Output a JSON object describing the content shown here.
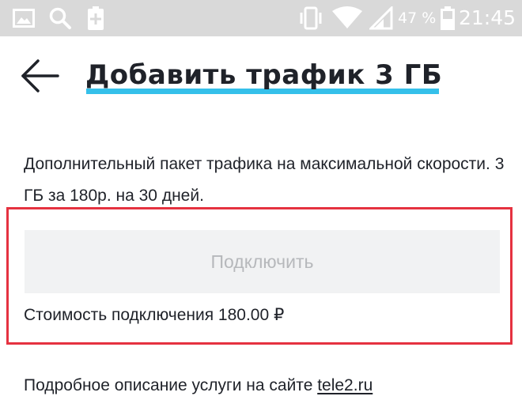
{
  "status_bar": {
    "battery_percent": "47 %",
    "time": "21:45",
    "icons": [
      "gallery-icon",
      "search-icon",
      "battery-saver-icon",
      "vibrate-icon",
      "wifi-icon",
      "signal-icon",
      "battery-icon"
    ]
  },
  "header": {
    "title": "Добавить трафик 3 ГБ",
    "back_icon": "arrow-left-icon",
    "underline_color": "#35c0ea"
  },
  "description": "Дополнительный пакет трафика на максимальной скорости. 3 ГБ за 180р. на 30 дней.",
  "connect": {
    "button_label": "Подключить",
    "cost_label": "Стоимость подключения 180.00 ₽",
    "highlight_color": "#e53240"
  },
  "footer": {
    "text": "Подробное описание услуги на сайте ",
    "link_label": "tele2.ru"
  }
}
